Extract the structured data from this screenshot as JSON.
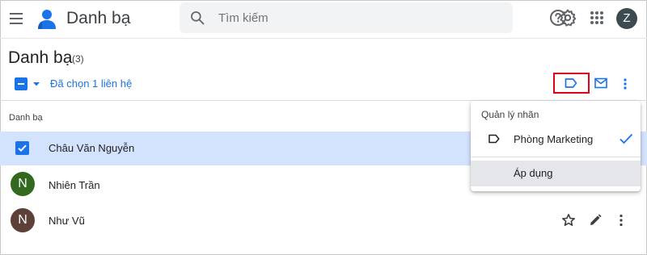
{
  "header": {
    "app_title": "Danh bạ",
    "search_placeholder": "Tìm kiếm",
    "avatar_letter": "Z"
  },
  "page": {
    "title": "Danh bạ",
    "count": "(3)"
  },
  "toolbar": {
    "selection_text": "Đã chọn 1 liên hệ"
  },
  "list": {
    "header": "Danh bạ",
    "contacts": [
      {
        "name": "Châu Văn Nguyễn",
        "selected": true,
        "avatar": "",
        "avatar_color": "#1a73e8"
      },
      {
        "name": "Nhiên Trần",
        "selected": false,
        "avatar": "N",
        "avatar_color": "#33691e"
      },
      {
        "name": "Như Vũ",
        "selected": false,
        "avatar": "N",
        "avatar_color": "#5d4037"
      }
    ]
  },
  "label_menu": {
    "title": "Quản lý nhãn",
    "labels": [
      {
        "name": "Phòng Marketing",
        "checked": true
      }
    ],
    "apply": "Áp dụng"
  },
  "colors": {
    "accent": "#1a73e8",
    "selected_row": "#d3e3fd",
    "highlight_box": "#e1001a"
  }
}
